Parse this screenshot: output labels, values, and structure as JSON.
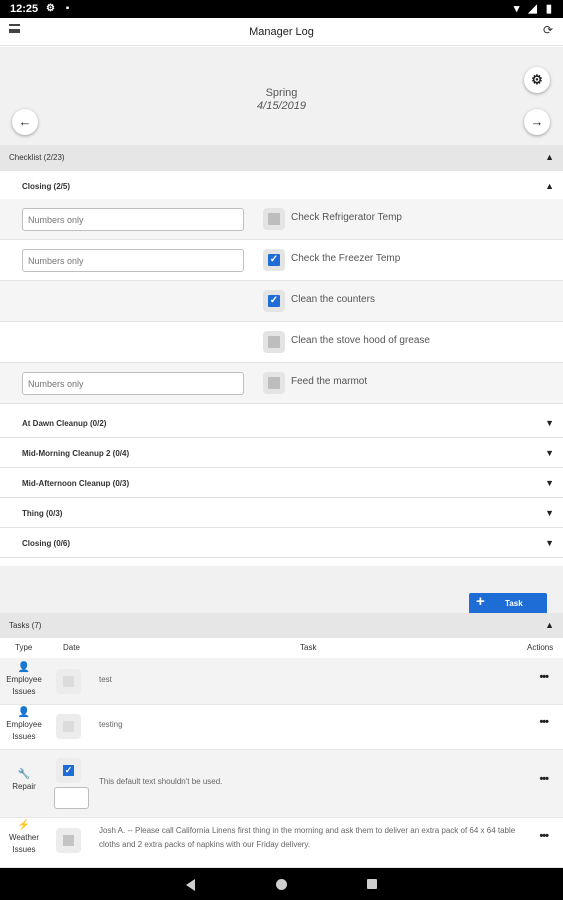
{
  "status_bar": {
    "time": "12:25",
    "left_icons": "⚙ ▪",
    "right_icons": "▾ ◢ ▮"
  },
  "app_bar": {
    "title": "Manager Log",
    "menu_icon": "hamburger-icon",
    "refresh_icon": "refresh-icon",
    "refresh_glyph": "⟳"
  },
  "header": {
    "season": "Spring",
    "date": "4/15/2019",
    "prev_glyph": "←",
    "next_glyph": "→",
    "settings_glyph": "⚙"
  },
  "checklist": {
    "label": "Checklist (2/23)",
    "closing": {
      "label": "Closing (2/5)",
      "items": [
        {
          "label": "Check Refrigerator Temp",
          "placeholder": "Numbers only",
          "checked": false
        },
        {
          "label": "Check the Freezer Temp",
          "placeholder": "Numbers only",
          "checked": true
        },
        {
          "label": "Clean the counters",
          "checked": true
        },
        {
          "label": "Clean the stove hood of grease",
          "checked": false
        },
        {
          "label": "Feed the marmot",
          "placeholder": "Numbers only",
          "checked": false
        }
      ]
    },
    "groups": [
      {
        "label": "At Dawn Cleanup (0/2)"
      },
      {
        "label": "Mid-Morning Cleanup 2 (0/4)"
      },
      {
        "label": "Mid-Afternoon Cleanup (0/3)"
      },
      {
        "label": "Thing (0/3)"
      },
      {
        "label": "Closing (0/6)"
      }
    ]
  },
  "add_task_button": {
    "label": "Task",
    "glyph": "+"
  },
  "tasks": {
    "label": "Tasks (7)",
    "columns": {
      "type": "Type",
      "date": "Date",
      "task": "Task",
      "actions": "Actions"
    },
    "rows": [
      {
        "type": "Employee Issues",
        "icon": "person-icon",
        "text": "test",
        "actions": "•••"
      },
      {
        "type": "Employee Issues",
        "icon": "person-icon",
        "text": "testing",
        "actions": "•••"
      },
      {
        "type": "Repair",
        "icon": "wrench-icon",
        "text": "This default text shouldn't be used.",
        "actions": "•••",
        "checked": true
      },
      {
        "type": "Weather Issues",
        "icon": "lightning-icon",
        "text": "Josh A. -- Please call California Linens first thing in the morning and ask them to deliver an extra pack of 64 x 64 table cloths and 2 extra packs of napkins with our Friday delivery.",
        "actions": "•••"
      }
    ]
  },
  "colors": {
    "accent": "#1e6dd6",
    "section_bg": "#e6e6e6"
  }
}
